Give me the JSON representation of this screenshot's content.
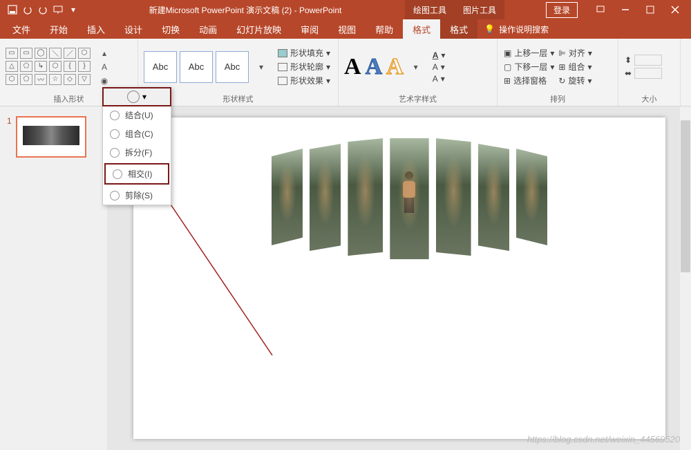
{
  "title": "新建Microsoft PowerPoint 演示文稿 (2) - PowerPoint",
  "contextTabs": [
    "绘图工具",
    "图片工具"
  ],
  "login": "登录",
  "tabs": {
    "file": "文件",
    "home": "开始",
    "insert": "插入",
    "design": "设计",
    "transitions": "切换",
    "animations": "动画",
    "slideshow": "幻灯片放映",
    "review": "审阅",
    "view": "视图",
    "help": "帮助",
    "format1": "格式",
    "format2": "格式"
  },
  "tellMe": "操作说明搜索",
  "groups": {
    "insertShapes": "插入形状",
    "shapeStyles": "形状样式",
    "wordArt": "艺术字样式",
    "arrange": "排列",
    "size": "大小"
  },
  "abc": "Abc",
  "shapeOpts": {
    "fill": "形状填充",
    "outline": "形状轮廓",
    "effects": "形状效果"
  },
  "arrange": {
    "bringForward": "上移一层",
    "sendBackward": "下移一层",
    "selectionPane": "选择窗格",
    "align": "对齐",
    "group": "组合",
    "rotate": "旋转"
  },
  "dropdown": {
    "union": "结合(U)",
    "combine": "组合(C)",
    "fragment": "拆分(F)",
    "intersect": "相交(I)",
    "subtract": "剪除(S)"
  },
  "slideNum": "1",
  "watermark": "https://blog.csdn.net/weixin_44569520"
}
